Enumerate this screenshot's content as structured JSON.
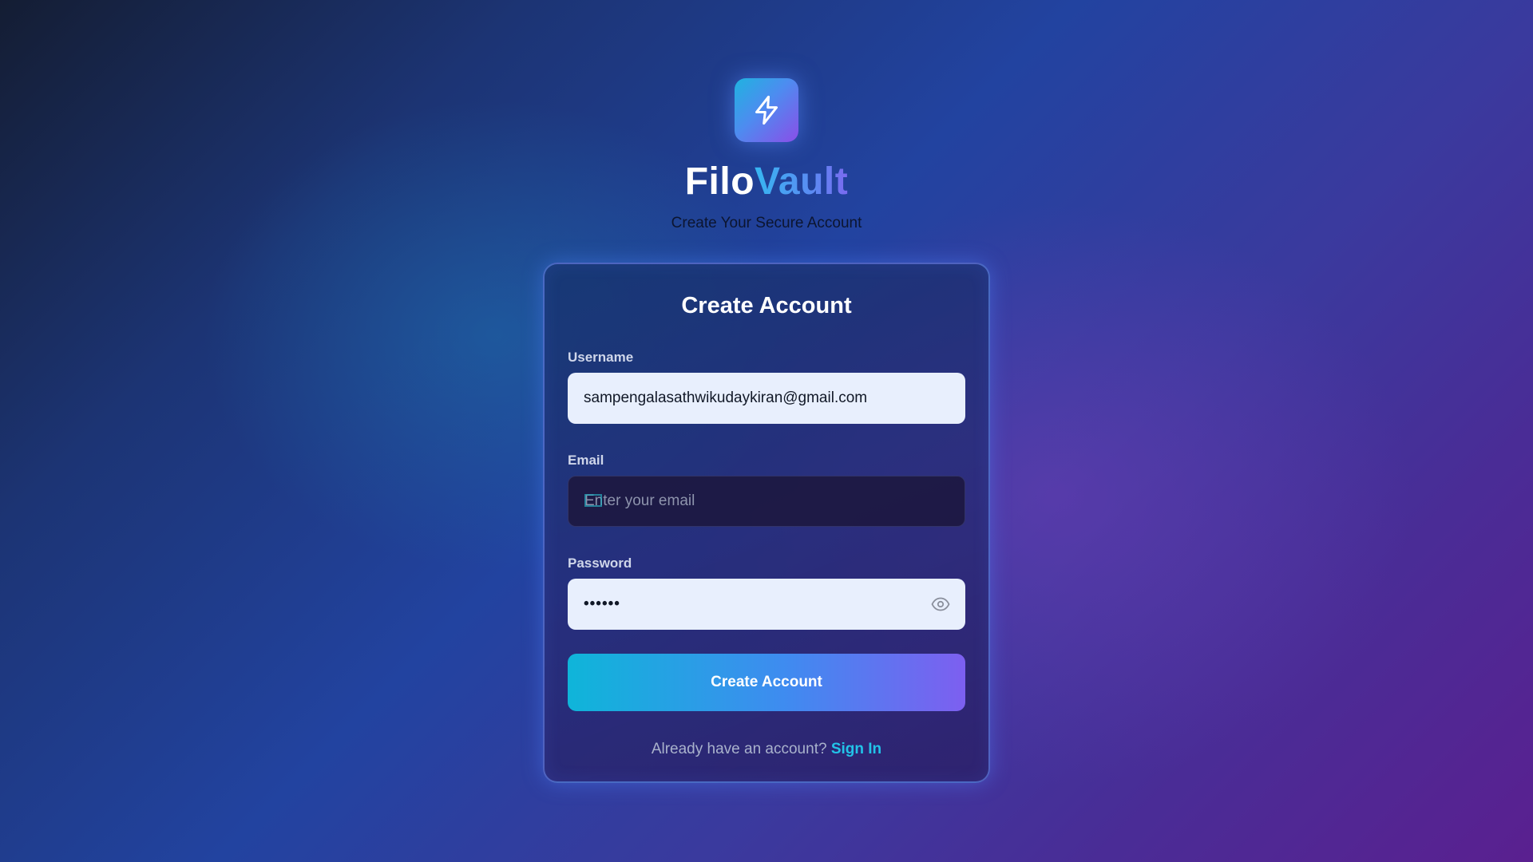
{
  "brand": {
    "name_part1": "Filo",
    "name_part2": "Vault",
    "subtitle": "Create Your Secure Account",
    "logo_icon": "lightning-bolt-icon"
  },
  "form": {
    "title": "Create Account",
    "username": {
      "label": "Username",
      "value": "sampengalasathwikudaykiran@gmail.com",
      "placeholder": ""
    },
    "email": {
      "label": "Email",
      "value": "",
      "placeholder": "Enter your email"
    },
    "password": {
      "label": "Password",
      "value": "••••••",
      "toggle_icon": "eye-icon"
    },
    "submit_label": "Create Account",
    "signin_prompt": "Already have an account?",
    "signin_link": "Sign In"
  },
  "colors": {
    "accent_cyan": "#22c3e8",
    "button_gradient_start": "#0fb5d9",
    "button_gradient_end": "#7d5ff0",
    "card_border": "#6e96ff"
  }
}
